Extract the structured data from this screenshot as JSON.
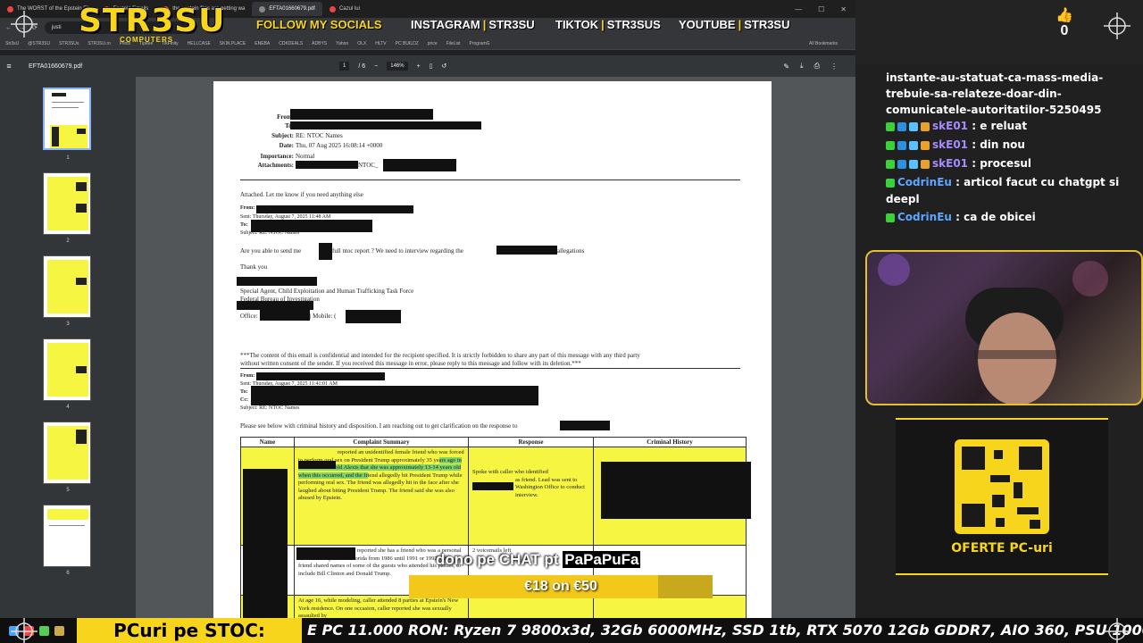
{
  "browser": {
    "tabs": [
      "The WORST of the Epstein Fil",
      "Epstein Emails",
      "the epstein files are getting wa",
      "EFTA01660679.pdf",
      "Cazul lui"
    ],
    "url": "justi",
    "bookmarks": [
      "Str3sU",
      "@STR3SU",
      "STR3SUs",
      "STR3SU.ro",
      "Pilots",
      "Tipeee",
      "TikFinity",
      "HELLCASE",
      "SKIN.PLACE",
      "ENEBA",
      "CDKDEALS",
      "ADBYS",
      "Yahoo",
      "OLX",
      "HLTV",
      "PC BUILDZ",
      "price",
      "FileList",
      "ProgramG"
    ],
    "all_bookmarks": "All Bookmarks"
  },
  "overlay": {
    "logo": "STR3SU",
    "logo_sub": "COMPUTERS",
    "follow": "FOLLOW MY SOCIALS",
    "instagram": "INSTAGRAM",
    "instagram_handle": "STR3SU",
    "tiktok": "TIKTOK",
    "tiktok_handle": "STR3SUS",
    "youtube": "YOUTUBE",
    "youtube_handle": "STR3SU",
    "separator": "|"
  },
  "pdf": {
    "filename": "EFTA01660679.pdf",
    "page_current": "1",
    "page_total": "/ 6",
    "zoom": "146%",
    "thumb_numbers": [
      "1",
      "2",
      "3",
      "4",
      "5",
      "6"
    ],
    "header": {
      "from_label": "From:",
      "to_label": "To:",
      "subject_label": "Subject:",
      "subject": "RE: NTOC Names",
      "date_label": "Date:",
      "date": "Thu, 07 Aug 2025 16:08:14 +0000",
      "importance_label": "Importance:",
      "importance": "Normal",
      "attachments_label": "Attachments:",
      "attachments": "NTOC_"
    },
    "body": {
      "attached": "Attached.  Let me know if you need anything else",
      "from1": "From:",
      "sent1": "Sent: Thursday, August 7, 2025 11:48 AM",
      "to1": "To:",
      "subject1": "Subject: RE: NTOC Names",
      "ask_pre": "Are you able to send me",
      "ask_mid": "full ntoc report ? We need to interview regarding the",
      "ask_post": "allegations",
      "thanks": "Thank you",
      "sig1": "Special Agent, Child Exploitation and Human Trafficking Task Force",
      "sig2": "Federal Bureau of Investigation",
      "office": "Office:",
      "mobile": "| Mobile: (",
      "conf1": "***The content of this email is confidential and intended for the recipient specified. It is strictly forbidden to share any part of this message with any third party",
      "conf2": "without written consent of the sender. If you received this message in error, please reply to this message and follow with its deletion.***",
      "from2": "From:",
      "sent2": "Sent: Thursday, August 7, 2025 11:41:01 AM",
      "to2": "To:",
      "cc2": "Cc:",
      "subject2": "Subject: RE: NTOC Names",
      "please": "Please see below with criminal history and disposition.  I am reaching out to get clarification on the response to"
    },
    "table": {
      "headers": [
        "Name",
        "Complaint Summary",
        "Response",
        "Criminal History"
      ],
      "row1_summary_a": "reported an unidentified female friend who was forced to perform oral sex on President Trump approximately 35 ye",
      "row1_summary_hl": "ars ago in NJ. The friend told Alexis that she was approximately 13-14 years old when this occurred, and the fr",
      "row1_summary_b": "iend allegedly bit President Trump while performing oral sex. The friend was allegedly hit in the face after she laughed about biting President Trump. The friend said she was also abused by Epstein.",
      "row1_response_a": "Spoke with caller who identified",
      "row1_response_b": "as friend. Lead was sent to Washington Office to conduct interview.",
      "row2_summary": "reported she has a friend who was a personal assistant to Epstein in Florida from 1986 until 1991 or 1992. This friend shared names of some of the guests who attended his parties, to include Bill Clinton and Donald Trump.",
      "row2_response": "2 voicemails left",
      "row3_summary": "At age 16, while modeling, caller attended 8 parties at Epstein's New York residence. On one occasion, caller reported she was sexually assaulted by"
    }
  },
  "alert": {
    "message_pre": "dono pe CHAT pt",
    "donor": "PaPaPuFa",
    "amount": "€18 on €50",
    "progress_fraction": 0.82
  },
  "stream": {
    "like_count": "0",
    "chat": [
      {
        "user": "",
        "text": "instante-au-statuat-ca-mass-media-trebuie-sa-relateze-doar-din-comunicatele-autoritatilor-5250495",
        "badges": []
      },
      {
        "user": "skE01",
        "text": "e reluat",
        "badges": [
          "#3ad13a",
          "#2d8fe0",
          "#5bc0ff",
          "#e8a22c"
        ]
      },
      {
        "user": "skE01",
        "text": "din nou",
        "badges": [
          "#3ad13a",
          "#2d8fe0",
          "#5bc0ff",
          "#e8a22c"
        ]
      },
      {
        "user": "skE01",
        "text": "procesul",
        "badges": [
          "#3ad13a",
          "#2d8fe0",
          "#5bc0ff",
          "#e8a22c"
        ]
      },
      {
        "user": "CodrinEu",
        "text": "articol facut cu chatgpt si deepl",
        "badges": [
          "#3ad13a"
        ]
      },
      {
        "user": "CodrinEu",
        "text": "ca de obicei",
        "badges": [
          "#3ad13a"
        ]
      }
    ],
    "promo_label": "OFERTE PC-uri"
  },
  "ticker": {
    "label": "PCuri pe STOC:",
    "text": "E PC 11.000 RON: Ryzen 7 9800x3d, 32Gb 6000MHz, SSD 1tb, RTX 5070 12Gb GDDR7, AIO 360, PSU 1000W",
    "text_tail": "E"
  },
  "colors": {
    "accent": "#f7d51d",
    "page_highlight": "#f5f542",
    "text_highlight": "#7fd46a"
  }
}
